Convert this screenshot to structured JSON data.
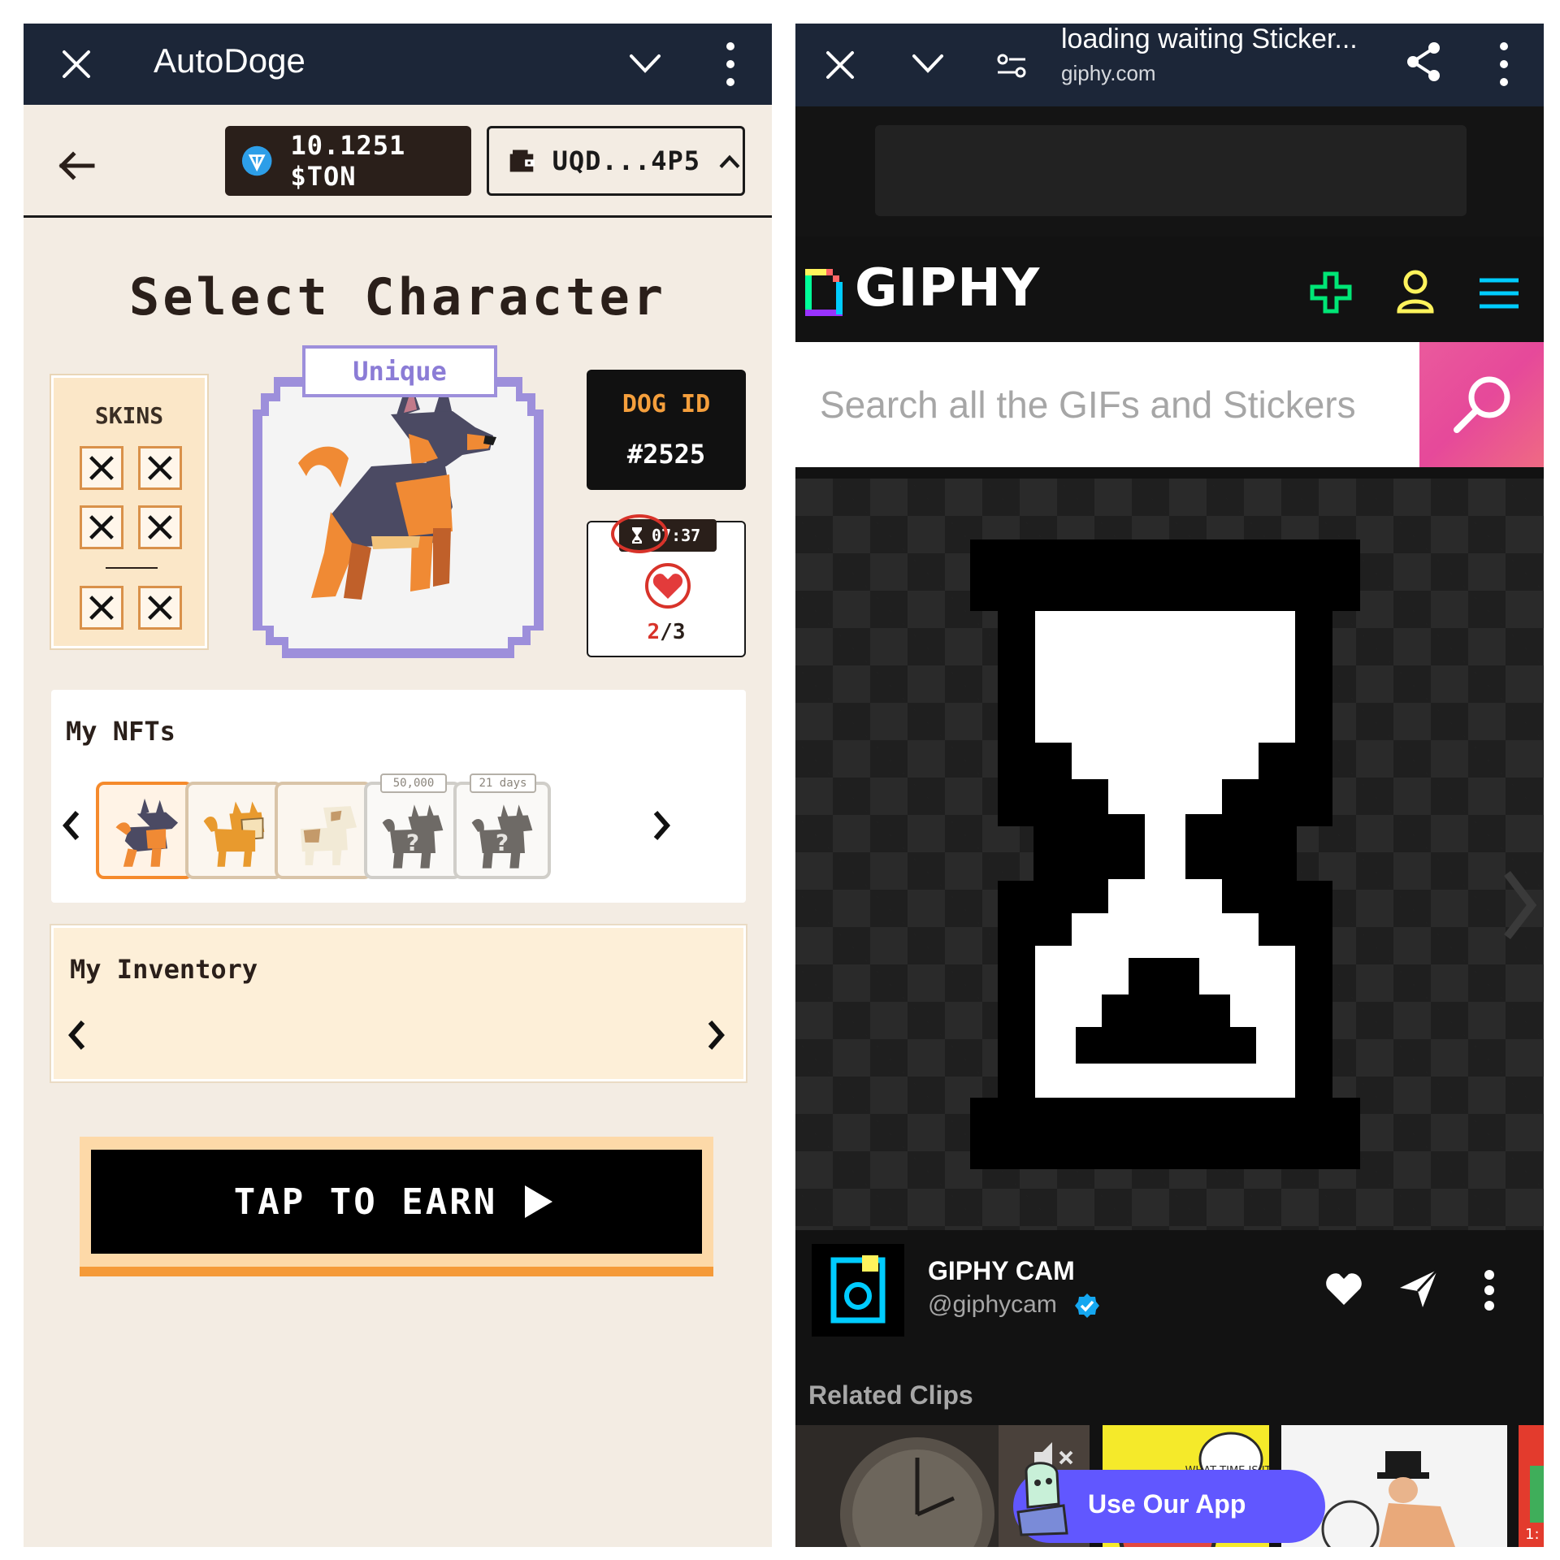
{
  "left": {
    "topbar": {
      "title": "AutoDoge"
    },
    "balance": {
      "amount": "10.1251 $TON"
    },
    "wallet": {
      "address": "UQD...4P5"
    },
    "heading": "Select Character",
    "skins": {
      "label": "SKINS"
    },
    "character": {
      "rarity": "Unique"
    },
    "dog_id": {
      "label": "DOG ID",
      "value": "#2525"
    },
    "energy": {
      "timer": "07:37",
      "current": "2",
      "separator": "/",
      "max": "3"
    },
    "nfts": {
      "title": "My NFTs",
      "items": [
        {
          "name": "german-shepherd",
          "tag": ""
        },
        {
          "name": "shiba",
          "tag": ""
        },
        {
          "name": "bulldog",
          "tag": ""
        },
        {
          "name": "locked",
          "tag": "50,000"
        },
        {
          "name": "locked",
          "tag": "21 days"
        }
      ]
    },
    "inventory": {
      "title": "My Inventory"
    },
    "cta": {
      "label": "TAP TO EARN"
    },
    "colors": {
      "accent": "#f59a38",
      "dark": "#2a1f1a",
      "bg": "#f3ece3",
      "rarity": "#9d8fdb"
    }
  },
  "right": {
    "topbar": {
      "title": "loading waiting Sticker...",
      "url": "giphy.com"
    },
    "giphy": {
      "logo": "GIPHY",
      "search_placeholder": "Search all the GIFs and Stickers",
      "creator_name": "GIPHY CAM",
      "creator_handle": "@giphycam",
      "related_title": "Related Clips",
      "clip_bubble": "WHAT TIME IS IT?",
      "clip_corner": "1:",
      "use_app": "Use Our App"
    },
    "colors": {
      "search_button": "#e6499a",
      "plus": "#00e676",
      "user": "#fff35c",
      "menu": "#00ccff",
      "use_app": "#6157ff"
    }
  }
}
